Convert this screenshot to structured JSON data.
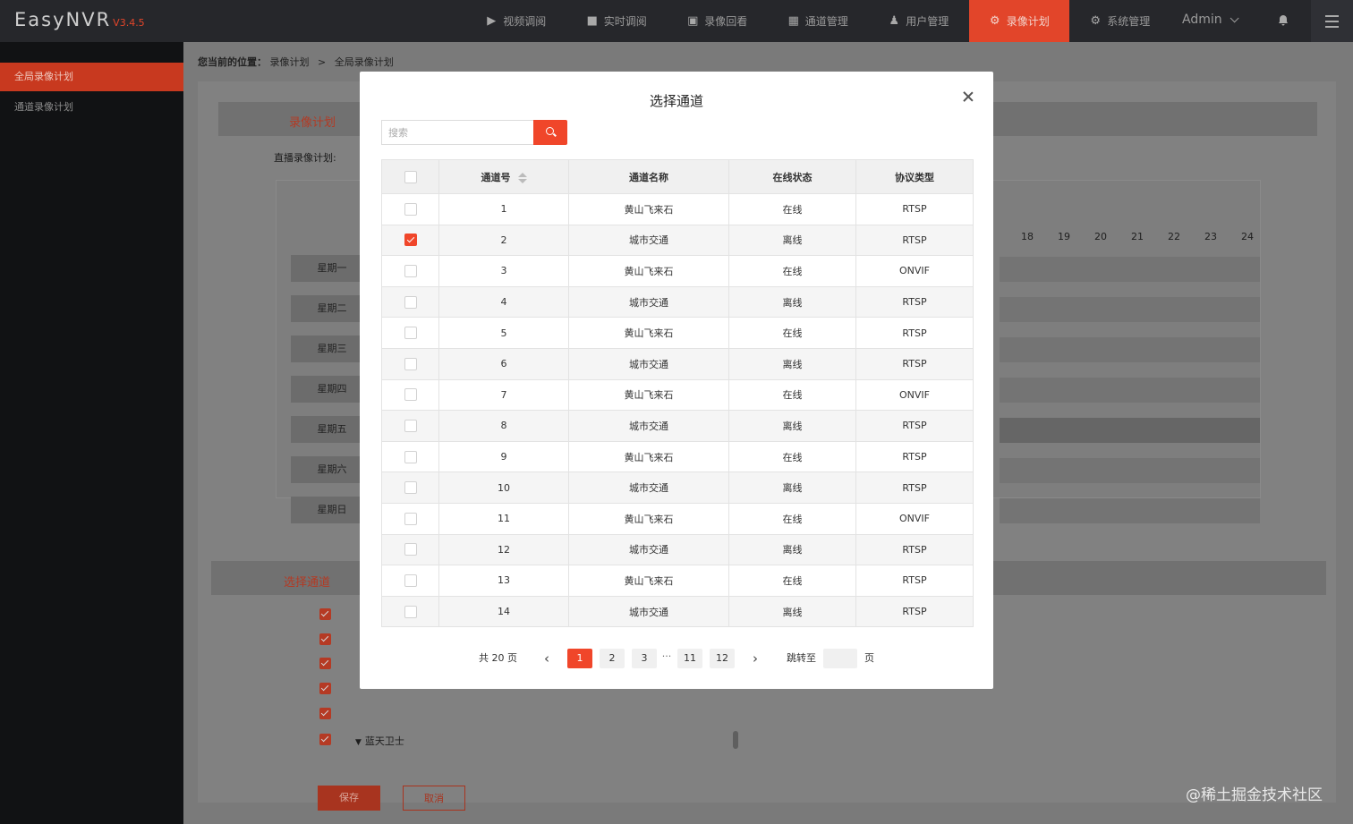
{
  "app": {
    "name": "EasyNVR",
    "version": "V3.4.5"
  },
  "nav": [
    {
      "label": "视频调阅",
      "icon": "play-circle-icon",
      "glyph": "▶"
    },
    {
      "label": "实时调阅",
      "icon": "camera-icon",
      "glyph": "■"
    },
    {
      "label": "录像回看",
      "icon": "film-icon",
      "glyph": "▣"
    },
    {
      "label": "通道管理",
      "icon": "columns-icon",
      "glyph": "▦"
    },
    {
      "label": "用户管理",
      "icon": "user-icon",
      "glyph": "♟"
    },
    {
      "label": "录像计划",
      "icon": "gear-icon",
      "glyph": "⚙",
      "active": true
    },
    {
      "label": "系统管理",
      "icon": "gear-icon",
      "glyph": "⚙"
    }
  ],
  "user": {
    "name": "Admin"
  },
  "sidebar": {
    "items": [
      {
        "label": "全局录像计划",
        "active": true
      },
      {
        "label": "通道录像计划"
      }
    ]
  },
  "breadcrumb": {
    "prefix": "您当前的位置：",
    "parent": "录像计划",
    "separator": ">",
    "current": "全局录像计划"
  },
  "background": {
    "section1_title": "录像计划",
    "plan_label": "直播录像计划:",
    "hours": [
      "18",
      "19",
      "20",
      "21",
      "22",
      "23",
      "24"
    ],
    "days": [
      "星期一",
      "星期二",
      "星期三",
      "星期四",
      "星期五",
      "星期六",
      "星期日"
    ],
    "section2_title": "选择通道",
    "last_channel": "蓝天卫士",
    "save_label": "保存",
    "cancel_label": "取消"
  },
  "modal": {
    "title": "选择通道",
    "search_placeholder": "搜索",
    "columns": [
      "通道号",
      "通道名称",
      "在线状态",
      "协议类型"
    ],
    "rows": [
      {
        "id": "1",
        "name": "黄山飞来石",
        "status": "在线",
        "online": true,
        "protocol": "RTSP",
        "checked": false
      },
      {
        "id": "2",
        "name": "城市交通",
        "status": "离线",
        "online": false,
        "protocol": "RTSP",
        "checked": true
      },
      {
        "id": "3",
        "name": "黄山飞来石",
        "status": "在线",
        "online": true,
        "protocol": "ONVIF",
        "checked": false
      },
      {
        "id": "4",
        "name": "城市交通",
        "status": "离线",
        "online": false,
        "protocol": "RTSP",
        "checked": false
      },
      {
        "id": "5",
        "name": "黄山飞来石",
        "status": "在线",
        "online": true,
        "protocol": "RTSP",
        "checked": false
      },
      {
        "id": "6",
        "name": "城市交通",
        "status": "离线",
        "online": false,
        "protocol": "RTSP",
        "checked": false
      },
      {
        "id": "7",
        "name": "黄山飞来石",
        "status": "在线",
        "online": true,
        "protocol": "ONVIF",
        "checked": false
      },
      {
        "id": "8",
        "name": "城市交通",
        "status": "离线",
        "online": false,
        "protocol": "RTSP",
        "checked": false
      },
      {
        "id": "9",
        "name": "黄山飞来石",
        "status": "在线",
        "online": true,
        "protocol": "RTSP",
        "checked": false
      },
      {
        "id": "10",
        "name": "城市交通",
        "status": "离线",
        "online": false,
        "protocol": "RTSP",
        "checked": false
      },
      {
        "id": "11",
        "name": "黄山飞来石",
        "status": "在线",
        "online": true,
        "protocol": "ONVIF",
        "checked": false
      },
      {
        "id": "12",
        "name": "城市交通",
        "status": "离线",
        "online": false,
        "protocol": "RTSP",
        "checked": false
      },
      {
        "id": "13",
        "name": "黄山飞来石",
        "status": "在线",
        "online": true,
        "protocol": "RTSP",
        "checked": false
      },
      {
        "id": "14",
        "name": "城市交通",
        "status": "离线",
        "online": false,
        "protocol": "RTSP",
        "checked": false
      }
    ],
    "pagination": {
      "total_text": "共 20 页",
      "pages": [
        "1",
        "2",
        "3",
        "11",
        "12"
      ],
      "current": "1",
      "ellipsis": "···",
      "jump_label": "跳转至",
      "page_suffix": "页",
      "prev": "‹",
      "next": "›"
    }
  },
  "watermark": "@稀土掘金技术社区",
  "colors": {
    "accent": "#f0462a",
    "online": "#3aa34a",
    "topbar": "#26272b"
  }
}
